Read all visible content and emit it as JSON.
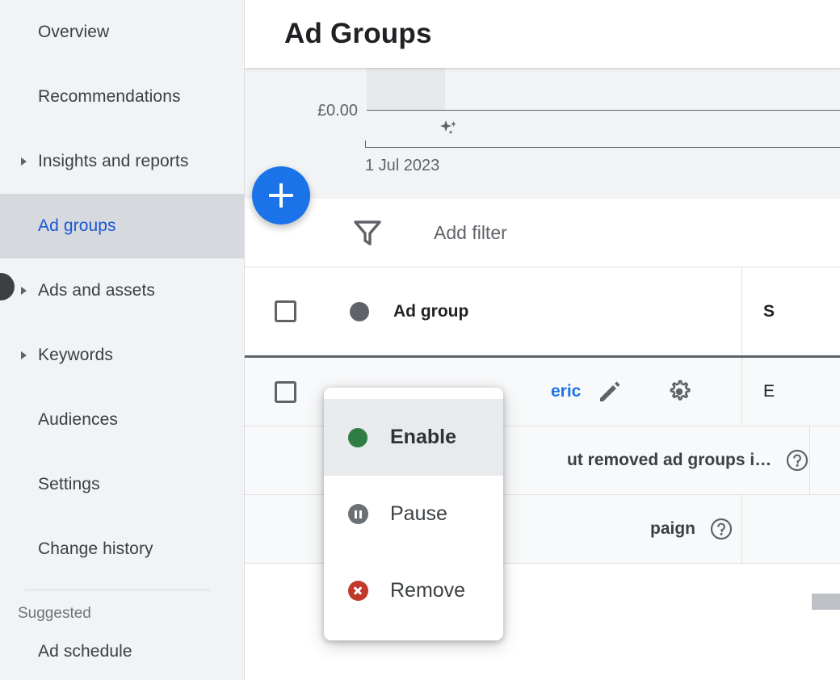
{
  "sidebar": {
    "items": [
      {
        "label": "Overview",
        "expandable": false,
        "active": false
      },
      {
        "label": "Recommendations",
        "expandable": false,
        "active": false
      },
      {
        "label": "Insights and reports",
        "expandable": true,
        "active": false
      },
      {
        "label": "Ad groups",
        "expandable": false,
        "active": true
      },
      {
        "label": "Ads and assets",
        "expandable": true,
        "active": false
      },
      {
        "label": "Keywords",
        "expandable": true,
        "active": false
      },
      {
        "label": "Audiences",
        "expandable": false,
        "active": false
      },
      {
        "label": "Settings",
        "expandable": false,
        "active": false
      },
      {
        "label": "Change history",
        "expandable": false,
        "active": false
      }
    ],
    "section_title": "Suggested",
    "suggested_items": [
      {
        "label": "Ad schedule"
      }
    ],
    "active_color": "#1a56d6",
    "active_bg": "#d6d9dd",
    "bg": "#f1f3f4"
  },
  "header": {
    "title": "Ad Groups"
  },
  "chart": {
    "y_label": "£0.00",
    "x_label": "1 Jul 2023",
    "sparkle_icon": "sparkle-icon"
  },
  "fab": {
    "icon": "plus-icon",
    "color": "#1a73e8"
  },
  "filter_bar": {
    "icon": "filter-funnel-icon",
    "label": "Add filter"
  },
  "table": {
    "columns": {
      "checkbox": "select-all",
      "status_icon": "status-dot-icon",
      "ad_group": "Ad group",
      "status": "S"
    },
    "rows": [
      {
        "name_fragment": "eric",
        "edit_icon": "pencil-icon",
        "gear_icon": "gear-icon",
        "status": "E",
        "has_checkbox": true
      },
      {
        "name_fragment": "ut removed ad groups i…",
        "help_icon": "help-circle-icon",
        "status": "",
        "has_checkbox": false
      },
      {
        "name_fragment": "paign",
        "help_icon": "help-circle-icon",
        "status": "",
        "has_checkbox": false
      }
    ]
  },
  "menu": {
    "items": [
      {
        "label": "Enable",
        "icon": "enabled-dot-icon",
        "icon_color": "#2f7d43",
        "highlighted": true
      },
      {
        "label": "Pause",
        "icon": "pause-circle-icon",
        "icon_color": "#6b7074",
        "highlighted": false
      },
      {
        "label": "Remove",
        "icon": "remove-circle-icon",
        "icon_color": "#c1392b",
        "highlighted": false
      }
    ]
  }
}
